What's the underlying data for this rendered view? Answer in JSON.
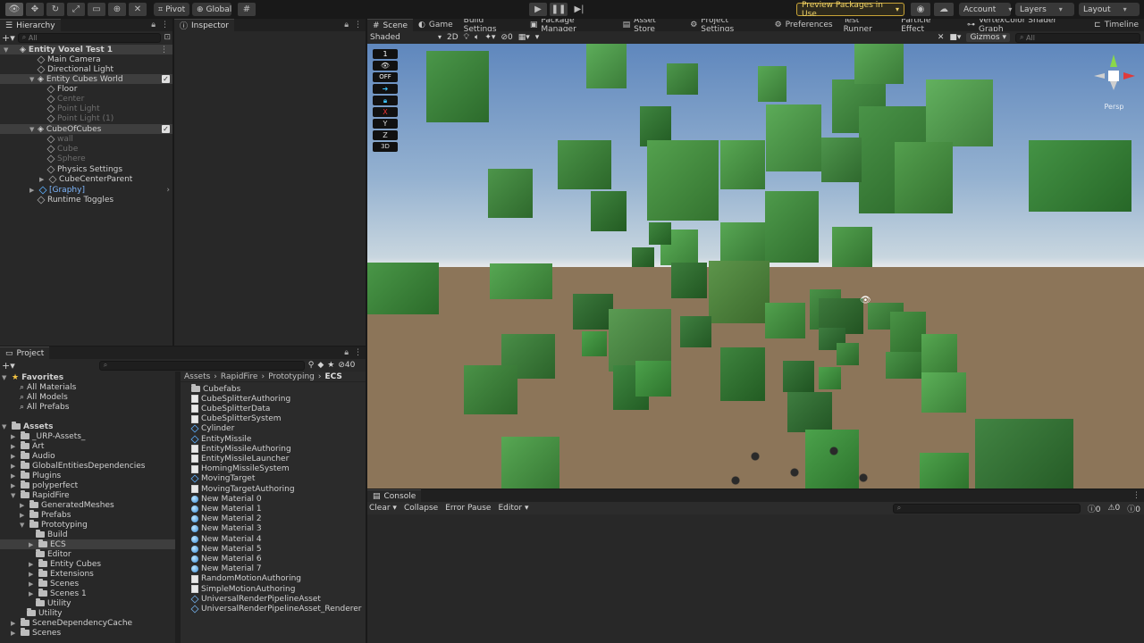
{
  "toolbar": {
    "pivot": "Pivot",
    "global": "Global",
    "preview_packages": "Preview Packages in Use",
    "account": "Account",
    "layers": "Layers",
    "layout": "Layout"
  },
  "hierarchy": {
    "title": "Hierarchy",
    "search_placeholder": "All",
    "items": [
      {
        "label": "Entity Voxel Test 1"
      },
      {
        "label": "Main Camera"
      },
      {
        "label": "Directional Light"
      },
      {
        "label": "Entity Cubes World"
      },
      {
        "label": "Floor"
      },
      {
        "label": "Center"
      },
      {
        "label": "Point Light"
      },
      {
        "label": "Point Light (1)"
      },
      {
        "label": "CubeOfCubes"
      },
      {
        "label": "wall"
      },
      {
        "label": "Cube"
      },
      {
        "label": "Sphere"
      },
      {
        "label": "Physics Settings"
      },
      {
        "label": "CubeCenterParent"
      },
      {
        "label": "[Graphy]"
      },
      {
        "label": "Runtime Toggles"
      }
    ]
  },
  "inspector": {
    "title": "Inspector"
  },
  "scene_tabs": [
    {
      "label": "Scene"
    },
    {
      "label": "Game"
    },
    {
      "label": "Build Settings"
    },
    {
      "label": "Package Manager"
    },
    {
      "label": "Asset Store"
    },
    {
      "label": "Project Settings"
    },
    {
      "label": "Preferences"
    },
    {
      "label": "Test Runner"
    },
    {
      "label": "Particle Effect"
    },
    {
      "label": "VertexColor Shader Graph"
    },
    {
      "label": "Timeline"
    }
  ],
  "scene_toolbar": {
    "shading": "Shaded",
    "mode_2d": "2D",
    "hidden_count": "0",
    "gizmos": "Gizmos",
    "search_placeholder": "All"
  },
  "overlay": {
    "b1": "1",
    "b3": "OFF",
    "x": "X",
    "y": "Y",
    "z": "Z",
    "d3": "3D",
    "persp": "Persp"
  },
  "project": {
    "title": "Project",
    "count": "40",
    "favorites_label": "Favorites",
    "favorites": [
      "All Materials",
      "All Models",
      "All Prefabs"
    ],
    "assets_label": "Assets",
    "tree": [
      {
        "label": "_URP-Assets_"
      },
      {
        "label": "Art"
      },
      {
        "label": "Audio"
      },
      {
        "label": "GlobalEntitiesDependencies"
      },
      {
        "label": "Plugins"
      },
      {
        "label": "polyperfect"
      },
      {
        "label": "RapidFire"
      },
      {
        "label": "GeneratedMeshes"
      },
      {
        "label": "Prefabs"
      },
      {
        "label": "Prototyping"
      },
      {
        "label": "Build"
      },
      {
        "label": "ECS"
      },
      {
        "label": "Editor"
      },
      {
        "label": "Entity Cubes"
      },
      {
        "label": "Extensions"
      },
      {
        "label": "Scenes"
      },
      {
        "label": "Scenes 1"
      },
      {
        "label": "Utility"
      },
      {
        "label": "Utility"
      },
      {
        "label": "SceneDependencyCache"
      },
      {
        "label": "Scenes"
      }
    ],
    "breadcrumb": [
      "Assets",
      "RapidFire",
      "Prototyping",
      "ECS"
    ],
    "files": [
      {
        "label": "Cubefabs",
        "icon": "folder-icon"
      },
      {
        "label": "CubeSplitterAuthoring",
        "icon": "script-icon"
      },
      {
        "label": "CubeSplitterData",
        "icon": "script-icon"
      },
      {
        "label": "CubeSplitterSystem",
        "icon": "script-icon"
      },
      {
        "label": "Cylinder",
        "icon": "prefab-icon"
      },
      {
        "label": "EntityMissile",
        "icon": "prefab-icon"
      },
      {
        "label": "EntityMissileAuthoring",
        "icon": "script-icon"
      },
      {
        "label": "EntityMissileLauncher",
        "icon": "script-icon"
      },
      {
        "label": "HomingMissileSystem",
        "icon": "script-icon"
      },
      {
        "label": "MovingTarget",
        "icon": "prefab-icon"
      },
      {
        "label": "MovingTargetAuthoring",
        "icon": "script-icon"
      },
      {
        "label": "New Material 0",
        "icon": "material-icon"
      },
      {
        "label": "New Material 1",
        "icon": "material-icon"
      },
      {
        "label": "New Material 2",
        "icon": "material-icon"
      },
      {
        "label": "New Material 3",
        "icon": "material-icon"
      },
      {
        "label": "New Material 4",
        "icon": "material-icon"
      },
      {
        "label": "New Material 5",
        "icon": "material-icon"
      },
      {
        "label": "New Material 6",
        "icon": "material-icon"
      },
      {
        "label": "New Material 7",
        "icon": "material-icon"
      },
      {
        "label": "RandomMotionAuthoring",
        "icon": "script-icon"
      },
      {
        "label": "SimpleMotionAuthoring",
        "icon": "script-icon"
      },
      {
        "label": "UniversalRenderPipelineAsset",
        "icon": "pipeline-icon"
      },
      {
        "label": "UniversalRenderPipelineAsset_Renderer",
        "icon": "pipeline-icon"
      }
    ]
  },
  "console": {
    "title": "Console",
    "clear": "Clear",
    "collapse": "Collapse",
    "error_pause": "Error Pause",
    "editor": "Editor",
    "info_count": "0",
    "warn_count": "0",
    "error_count": "0"
  }
}
